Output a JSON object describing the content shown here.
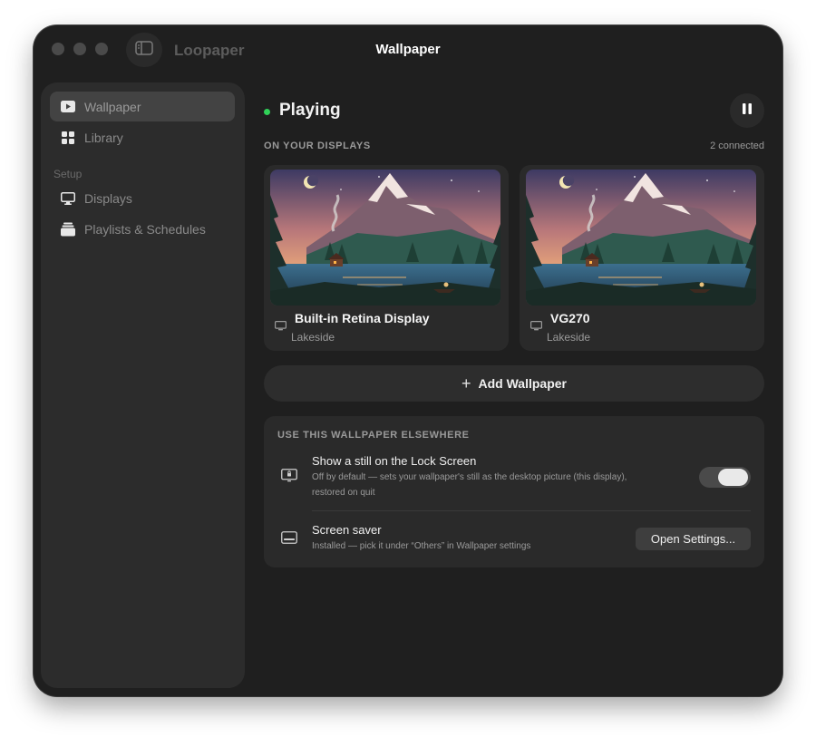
{
  "app": {
    "name": "Loopaper",
    "window_title": "Wallpaper"
  },
  "sidebar": {
    "items": [
      {
        "label": "Wallpaper",
        "icon": "play-icon",
        "active": true
      },
      {
        "label": "Library",
        "icon": "grid-icon",
        "active": false
      }
    ],
    "setup_label": "Setup",
    "setup_items": [
      {
        "label": "Displays",
        "icon": "monitor-icon"
      },
      {
        "label": "Playlists & Schedules",
        "icon": "stack-icon"
      }
    ]
  },
  "main": {
    "status": "Playing",
    "status_color": "#30d158",
    "displays_heading": "ON YOUR DISPLAYS",
    "connected_count": "2 connected",
    "displays": [
      {
        "name": "Built-in Retina Display",
        "wallpaper": "Lakeside"
      },
      {
        "name": "VG270",
        "wallpaper": "Lakeside"
      }
    ],
    "add_wallpaper_label": "Add Wallpaper",
    "elsewhere": {
      "heading": "USE THIS WALLPAPER ELSEWHERE",
      "lock_screen": {
        "title": "Show a still on the Lock Screen",
        "description": "Off by default — sets your wallpaper's still as the desktop picture (this display), restored on quit",
        "enabled": true
      },
      "screen_saver": {
        "title": "Screen saver",
        "description": "Installed — pick it under “Others” in Wallpaper settings",
        "button_label": "Open Settings..."
      }
    }
  }
}
